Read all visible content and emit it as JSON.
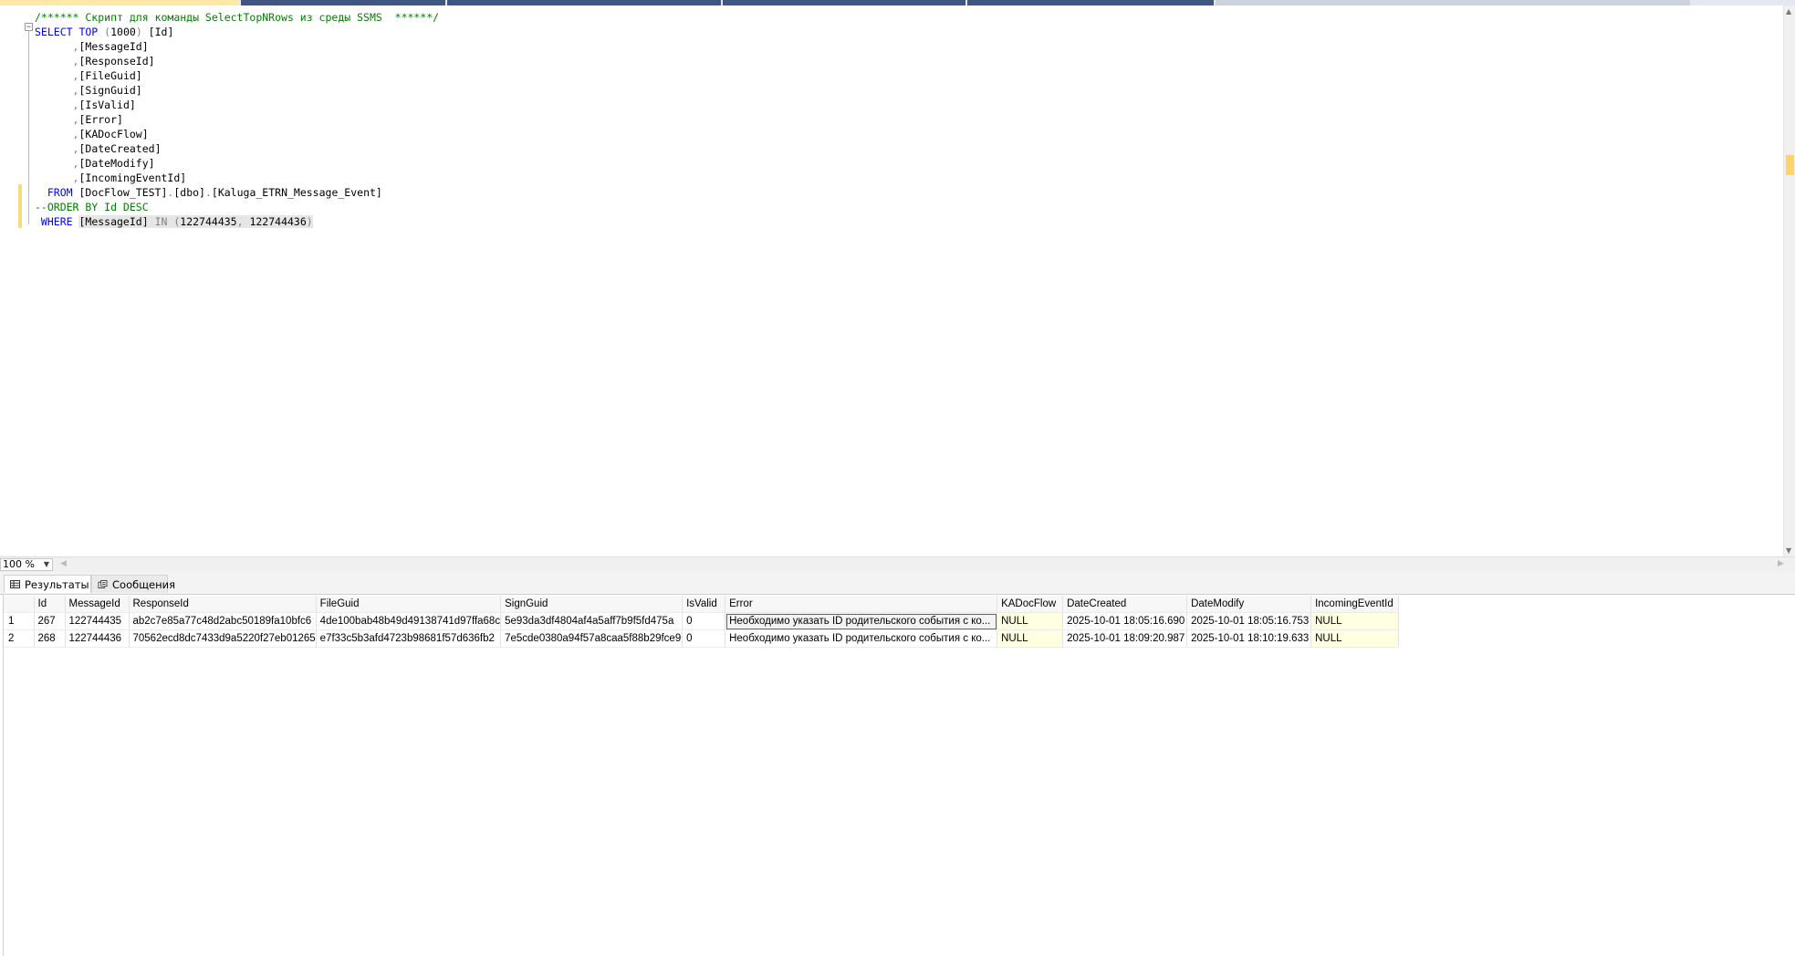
{
  "editor": {
    "lines": [
      {
        "parts": [
          {
            "t": "/****** Скрипт для команды SelectTopNRows из среды SSMS  ******/",
            "c": "cm"
          }
        ]
      },
      {
        "parts": [
          {
            "t": "SELECT TOP ",
            "c": "kw"
          },
          {
            "t": "(",
            "c": "gr"
          },
          {
            "t": "1000",
            "c": ""
          },
          {
            "t": ")",
            "c": "gr"
          },
          {
            "t": " [Id]",
            "c": ""
          }
        ]
      },
      {
        "parts": [
          {
            "t": "      ",
            "c": ""
          },
          {
            "t": ",",
            "c": "gr"
          },
          {
            "t": "[MessageId]",
            "c": ""
          }
        ]
      },
      {
        "parts": [
          {
            "t": "      ",
            "c": ""
          },
          {
            "t": ",",
            "c": "gr"
          },
          {
            "t": "[ResponseId]",
            "c": ""
          }
        ]
      },
      {
        "parts": [
          {
            "t": "      ",
            "c": ""
          },
          {
            "t": ",",
            "c": "gr"
          },
          {
            "t": "[FileGuid]",
            "c": ""
          }
        ]
      },
      {
        "parts": [
          {
            "t": "      ",
            "c": ""
          },
          {
            "t": ",",
            "c": "gr"
          },
          {
            "t": "[SignGuid]",
            "c": ""
          }
        ]
      },
      {
        "parts": [
          {
            "t": "      ",
            "c": ""
          },
          {
            "t": ",",
            "c": "gr"
          },
          {
            "t": "[IsValid]",
            "c": ""
          }
        ]
      },
      {
        "parts": [
          {
            "t": "      ",
            "c": ""
          },
          {
            "t": ",",
            "c": "gr"
          },
          {
            "t": "[Error]",
            "c": ""
          }
        ]
      },
      {
        "parts": [
          {
            "t": "      ",
            "c": ""
          },
          {
            "t": ",",
            "c": "gr"
          },
          {
            "t": "[KADocFlow]",
            "c": ""
          }
        ]
      },
      {
        "parts": [
          {
            "t": "      ",
            "c": ""
          },
          {
            "t": ",",
            "c": "gr"
          },
          {
            "t": "[DateCreated]",
            "c": ""
          }
        ]
      },
      {
        "parts": [
          {
            "t": "      ",
            "c": ""
          },
          {
            "t": ",",
            "c": "gr"
          },
          {
            "t": "[DateModify]",
            "c": ""
          }
        ]
      },
      {
        "parts": [
          {
            "t": "      ",
            "c": ""
          },
          {
            "t": ",",
            "c": "gr"
          },
          {
            "t": "[IncomingEventId]",
            "c": ""
          }
        ]
      },
      {
        "parts": [
          {
            "t": "  FROM ",
            "c": "kw"
          },
          {
            "t": "[DocFlow_TEST]",
            "c": ""
          },
          {
            "t": ".",
            "c": "gr"
          },
          {
            "t": "[dbo]",
            "c": ""
          },
          {
            "t": ".",
            "c": "gr"
          },
          {
            "t": "[Kaluga_ETRN_Message_Event]",
            "c": ""
          }
        ]
      },
      {
        "parts": [
          {
            "t": "--ORDER BY Id DESC",
            "c": "cm"
          }
        ]
      },
      {
        "parts": [
          {
            "t": " WHERE ",
            "c": "kw"
          },
          {
            "t": "[MessageId]",
            "c": "sel"
          },
          {
            "t": " IN ",
            "c": "selgr"
          },
          {
            "t": "(",
            "c": "selgr"
          },
          {
            "t": "122744435",
            "c": "sel"
          },
          {
            "t": ", ",
            "c": "selgr"
          },
          {
            "t": "122744436",
            "c": "sel"
          },
          {
            "t": ")",
            "c": "selgr"
          }
        ]
      }
    ]
  },
  "zoom": {
    "value": "100 %"
  },
  "results_tabs": [
    {
      "label": "Результаты",
      "icon": "grid-icon",
      "active": true
    },
    {
      "label": "Сообщения",
      "icon": "messages-icon",
      "active": false
    }
  ],
  "grid": {
    "columns": [
      "Id",
      "MessageId",
      "ResponseId",
      "FileGuid",
      "SignGuid",
      "IsValid",
      "Error",
      "KADocFlow",
      "DateCreated",
      "DateModify",
      "IncomingEventId"
    ],
    "rows": [
      {
        "rownum": "1",
        "cells": [
          "267",
          "122744435",
          "ab2c7e85a77c48d2abc50189fa10bfc6",
          "4de100bab48b49d49138741d97ffa68c",
          "5e93da3df4804af4a5aff7b9f5fd475a",
          "0",
          "Необходимо указать ID родительского события с ко...",
          "NULL",
          "2025-10-01 18:05:16.690",
          "2025-10-01 18:05:16.753",
          "NULL"
        ]
      },
      {
        "rownum": "2",
        "cells": [
          "268",
          "122744436",
          "70562ecd8dc7433d9a5220f27eb01265",
          "e7f33c5b3afd4723b98681f57d636fb2",
          "7e5cde0380a94f57a8caa5f88b29fce9",
          "0",
          "Необходимо указать ID родительского события с ко...",
          "NULL",
          "2025-10-01 18:09:20.987",
          "2025-10-01 18:10:19.633",
          "NULL"
        ]
      }
    ]
  }
}
